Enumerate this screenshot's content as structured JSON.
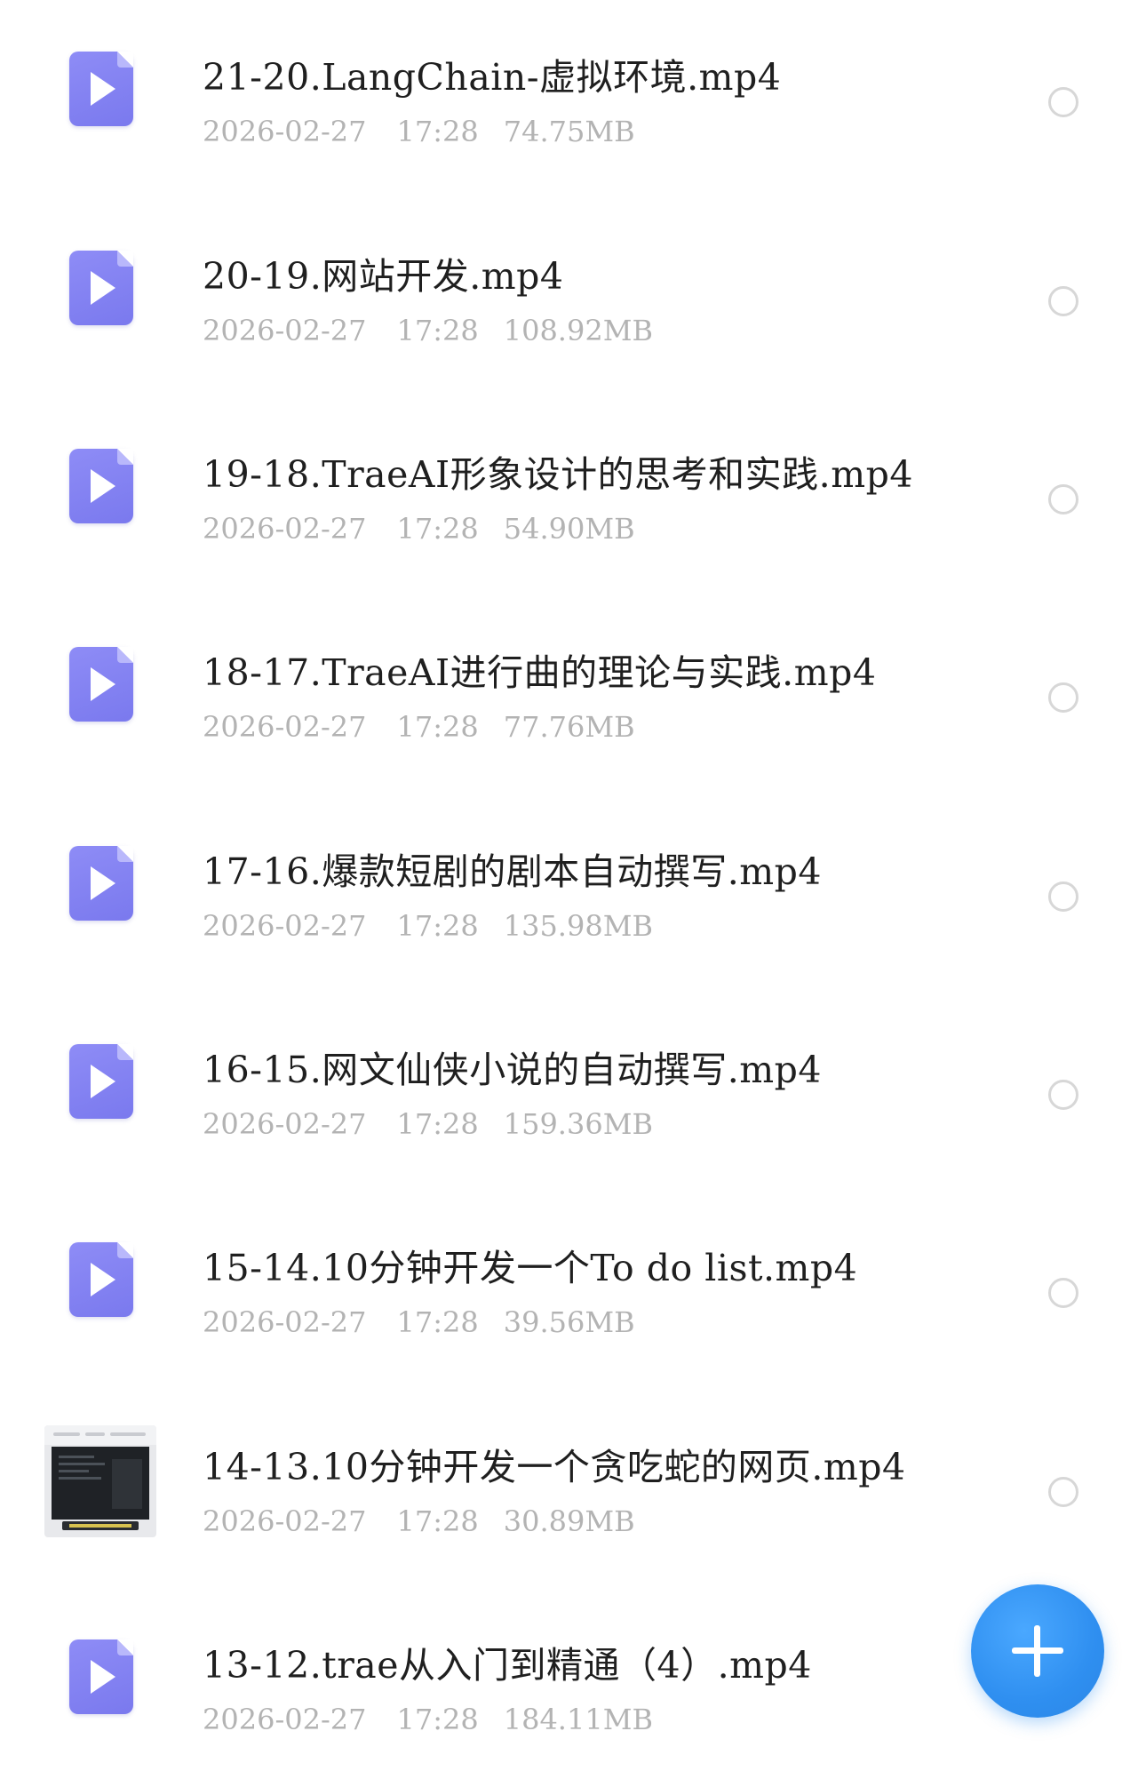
{
  "files": [
    {
      "name": "21-20.LangChain-虚拟环境.mp4",
      "date": "2026-02-27",
      "time": "17:28",
      "size": "74.75MB",
      "icon": "video-file-icon",
      "thumbnail": false
    },
    {
      "name": "20-19.网站开发.mp4",
      "date": "2026-02-27",
      "time": "17:28",
      "size": "108.92MB",
      "icon": "video-file-icon",
      "thumbnail": false
    },
    {
      "name": "19-18.TraeAI形象设计的思考和实践.mp4",
      "date": "2026-02-27",
      "time": "17:28",
      "size": "54.90MB",
      "icon": "video-file-icon",
      "thumbnail": false
    },
    {
      "name": "18-17.TraeAI进行曲的理论与实践.mp4",
      "date": "2026-02-27",
      "time": "17:28",
      "size": "77.76MB",
      "icon": "video-file-icon",
      "thumbnail": false
    },
    {
      "name": "17-16.爆款短剧的剧本自动撰写.mp4",
      "date": "2026-02-27",
      "time": "17:28",
      "size": "135.98MB",
      "icon": "video-file-icon",
      "thumbnail": false
    },
    {
      "name": "16-15.网文仙侠小说的自动撰写.mp4",
      "date": "2026-02-27",
      "time": "17:28",
      "size": "159.36MB",
      "icon": "video-file-icon",
      "thumbnail": false
    },
    {
      "name": "15-14.10分钟开发一个To do list.mp4",
      "date": "2026-02-27",
      "time": "17:28",
      "size": "39.56MB",
      "icon": "video-file-icon",
      "thumbnail": false
    },
    {
      "name": "14-13.10分钟开发一个贪吃蛇的网页.mp4",
      "date": "2026-02-27",
      "time": "17:28",
      "size": "30.89MB",
      "icon": "video-thumbnail-icon",
      "thumbnail": true
    },
    {
      "name": "13-12.trae从入门到精通（4）.mp4",
      "date": "2026-02-27",
      "time": "17:28",
      "size": "184.11MB",
      "icon": "video-file-icon",
      "thumbnail": false
    }
  ],
  "fab": {
    "icon": "plus-icon"
  },
  "colors": {
    "icon_purple": "#8e8cf6",
    "fab_blue": "#2f8ff0",
    "meta_gray": "#b3b3b3",
    "title": "#1f1f1f"
  }
}
